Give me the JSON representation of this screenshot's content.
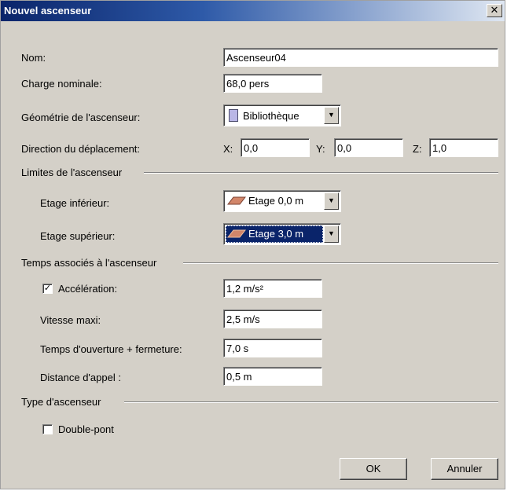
{
  "window": {
    "title": "Nouvel ascenseur",
    "close_label": "✕"
  },
  "fields": {
    "nom": {
      "label": "Nom:",
      "value": "Ascenseur04"
    },
    "charge": {
      "label": "Charge nominale:",
      "value": "68,0 pers"
    },
    "geometrie": {
      "label": "Géométrie de l'ascenseur:",
      "value": "Bibliothèque",
      "swatch_color": "#b9b6e6"
    },
    "direction": {
      "label": "Direction du déplacement:",
      "x_label": "X:",
      "x_value": "0,0",
      "y_label": "Y:",
      "y_value": "0,0",
      "z_label": "Z:",
      "z_value": "1,0"
    }
  },
  "limites": {
    "title": "Limites de l'ascenseur",
    "inferieur": {
      "label": "Etage inférieur:",
      "value": "Etage 0,0 m"
    },
    "superieur": {
      "label": "Etage supérieur:",
      "value": "Etage 3,0 m"
    }
  },
  "temps": {
    "title": "Temps associés à l'ascenseur",
    "acceleration": {
      "label": "Accélération:",
      "value": "1,2 m/s²",
      "checked": true
    },
    "vitesse": {
      "label": "Vitesse maxi:",
      "value": "2,5 m/s"
    },
    "ouverture": {
      "label": "Temps d'ouverture + fermeture:",
      "value": "7,0 s"
    },
    "distance": {
      "label": "Distance d'appel :",
      "value": "0,5 m"
    }
  },
  "type": {
    "title": "Type d'ascenseur",
    "double_pont": {
      "label": "Double-pont",
      "checked": false
    }
  },
  "buttons": {
    "ok": "OK",
    "cancel": "Annuler"
  },
  "colors": {
    "title_bar": "#0a246a",
    "dialog_bg": "#d4d0c8",
    "selection": "#0a246a",
    "floor_icon": "#d2866a"
  }
}
